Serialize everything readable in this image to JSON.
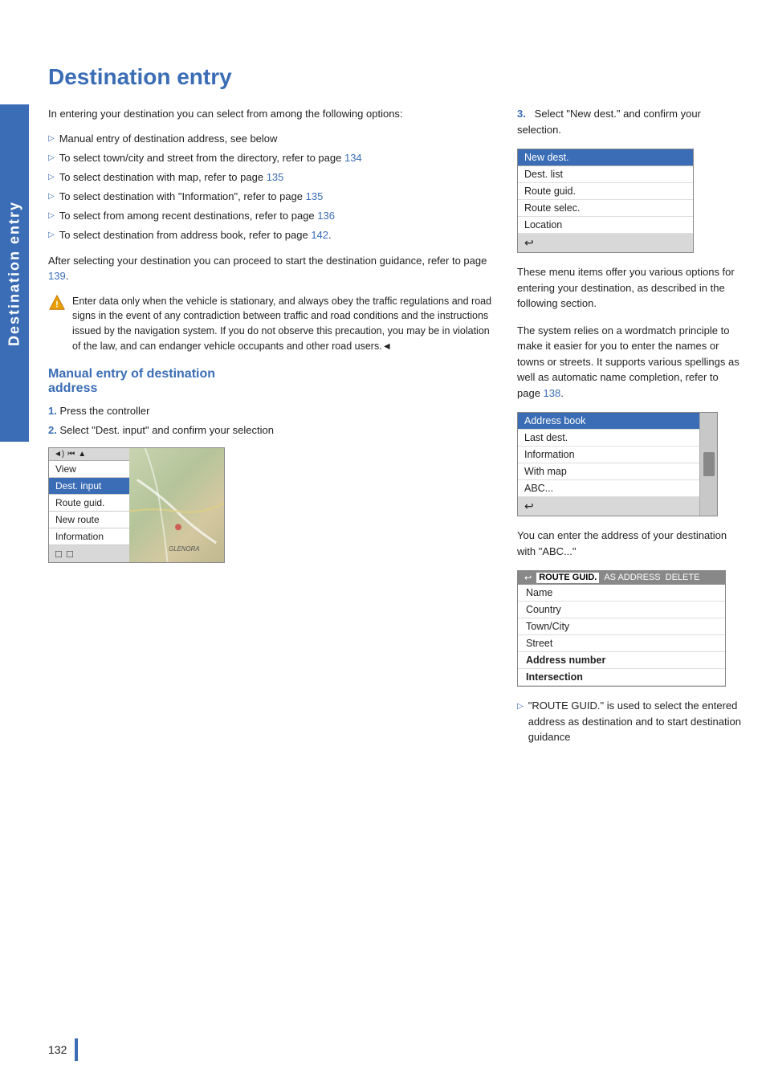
{
  "sidebar": {
    "label": "Destination entry"
  },
  "page": {
    "title": "Destination entry",
    "page_number": "132"
  },
  "intro": {
    "paragraph": "In entering your destination you can select from among the following options:"
  },
  "bullet_list": [
    {
      "text": "Manual entry of destination address, see below"
    },
    {
      "text": "To select town/city and street from the directory, refer to page ",
      "link": "134"
    },
    {
      "text": "To select destination with map, refer to page ",
      "link": "135"
    },
    {
      "text": "To select destination with \"Information\", refer to page ",
      "link": "135"
    },
    {
      "text": "To select from among recent destinations, refer to page ",
      "link": "136"
    },
    {
      "text": "To select destination from address book, refer to page ",
      "link": "142."
    }
  ],
  "after_list_para": "After selecting your destination you can proceed to start the destination guidance, refer to page 139.",
  "after_list_link": "139",
  "warning_text": "Enter data only when the vehicle is stationary, and always obey the traffic regulations and road signs in the event of any contradiction between traffic and road conditions and the instructions issued by the navigation system. If you do not observe this precaution, you may be in violation of the law, and can endanger vehicle occupants and other road users.◄",
  "section": {
    "heading": "Manual entry of destination address",
    "steps": [
      {
        "num": "1.",
        "text": "Press the controller"
      },
      {
        "num": "2.",
        "text": "Select \"Dest. input\" and confirm your selection"
      }
    ]
  },
  "menu1": {
    "items": [
      {
        "label": "View",
        "selected": false
      },
      {
        "label": "Dest. input",
        "selected": true
      },
      {
        "label": "Route guid.",
        "selected": false
      },
      {
        "label": "New route",
        "selected": false
      },
      {
        "label": "Information",
        "selected": false
      }
    ],
    "footer_icons": [
      "□",
      "□"
    ]
  },
  "right_col": {
    "step3_intro": "Select \"New dest.\" and confirm your selection.",
    "menu2_items": [
      {
        "label": "New dest.",
        "selected": true
      },
      {
        "label": "Dest. list",
        "selected": false
      },
      {
        "label": "Route guid.",
        "selected": false
      },
      {
        "label": "Route selec.",
        "selected": false
      },
      {
        "label": "Location",
        "selected": false
      }
    ],
    "para1": "These menu items offer you various options for entering your destination, as described in the following section.",
    "para2": "The system relies on a wordmatch principle to make it easier for you to enter the names or towns or streets. It supports various spellings as well as automatic name completion, refer to page 138.",
    "para2_link": "138",
    "menu3_items": [
      {
        "label": "Address book",
        "selected": true
      },
      {
        "label": "Last dest.",
        "selected": false
      },
      {
        "label": "Information",
        "selected": false
      },
      {
        "label": "With map",
        "selected": false
      },
      {
        "label": "ABC...",
        "selected": false
      }
    ],
    "para3": "You can enter the address of your destination with \"ABC...\"",
    "address_mockup": {
      "header_parts": [
        "←",
        "ROUTE GUID.",
        "AS ADDRESS",
        "DELETE"
      ],
      "highlighted": "ROUTE GUID.",
      "rows": [
        {
          "label": "Name"
        },
        {
          "label": "Country"
        },
        {
          "label": "Town/City"
        },
        {
          "label": "Street"
        },
        {
          "label": "Address number"
        },
        {
          "label": "Intersection"
        }
      ]
    },
    "note": "\"ROUTE GUID.\" is used to select the entered address as destination and to start destination guidance"
  }
}
